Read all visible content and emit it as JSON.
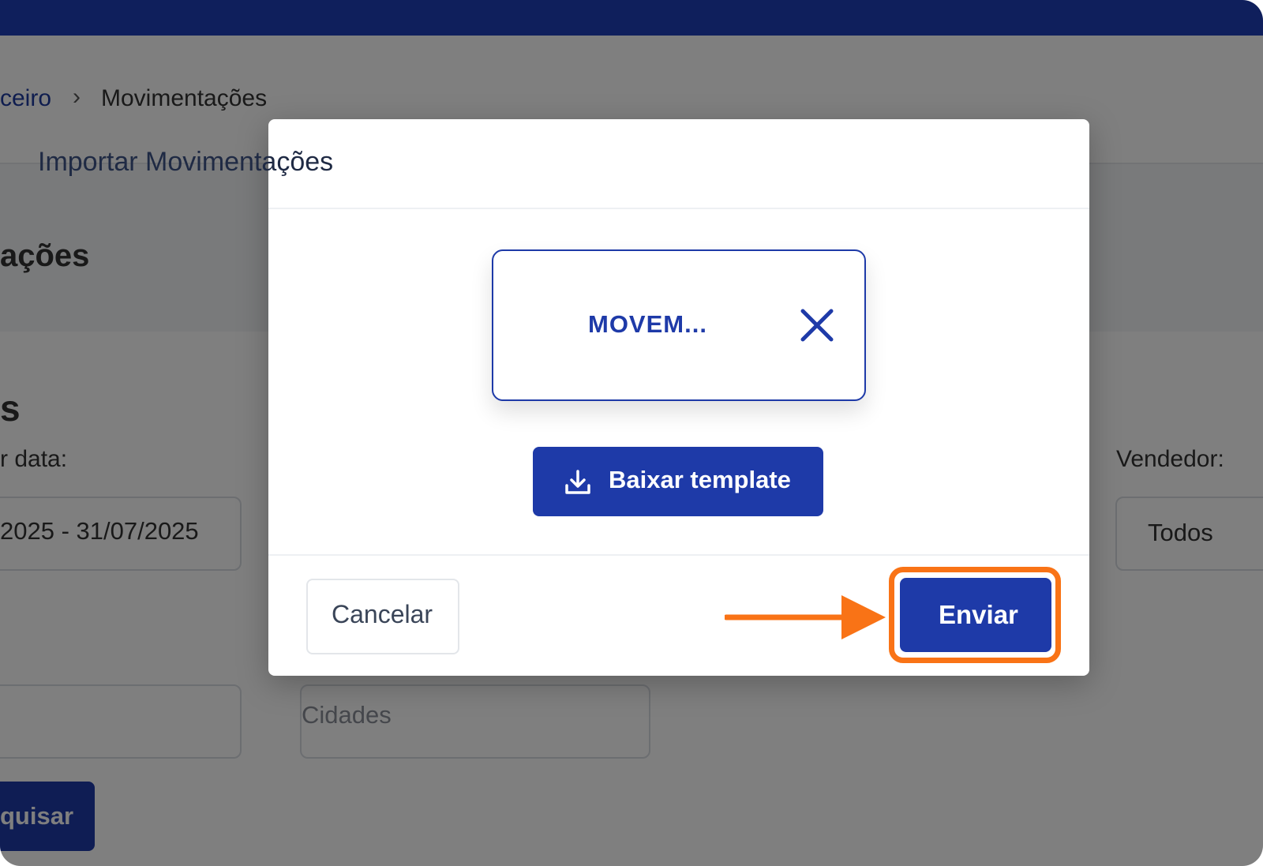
{
  "breadcrumb": {
    "parent": "ceiro",
    "separator": "›",
    "current": "Movimentações"
  },
  "page": {
    "title": "ações",
    "section_title": "s",
    "date_filter": {
      "label": "r data:",
      "value": "2025 - 31/07/2025"
    },
    "vendedor": {
      "label": "Vendedor:",
      "value": "Todos"
    },
    "cidades_placeholder": "Cidades",
    "search_label": "quisar"
  },
  "modal": {
    "title": "Importar Movimentações",
    "file_name": "MOVEM...",
    "download_label": "Baixar template",
    "cancel_label": "Cancelar",
    "send_label": "Enviar"
  },
  "icons": {
    "close": "close-icon",
    "download": "download-icon",
    "annotation_arrow": "arrow-right-icon"
  },
  "colors": {
    "topbar": "#0f1f5c",
    "primary": "#1e3aa8",
    "highlight": "#f97316",
    "overlay": "rgba(0,0,0,0.5)"
  }
}
